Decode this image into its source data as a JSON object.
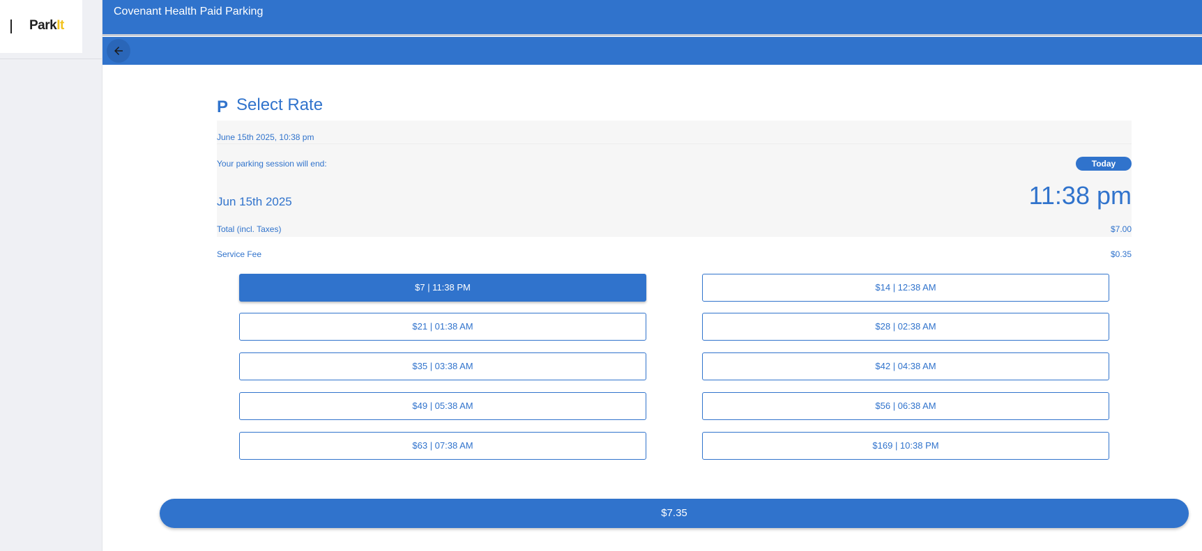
{
  "brand": {
    "logo_main": "Park",
    "logo_accent": "It"
  },
  "header": {
    "title": "Covenant Health Paid Parking"
  },
  "nav": {
    "back_icon": "arrow-left-icon"
  },
  "page": {
    "icon_glyph": "P",
    "title": "Select Rate"
  },
  "session": {
    "current_datetime": "June 15th 2025, 10:38 pm",
    "end_label": "Your parking session will end:",
    "badge": "Today",
    "end_date": "Jun 15th 2025",
    "end_time": "11:38 pm"
  },
  "fees": {
    "total_label": "Total (incl. Taxes)",
    "total_amount": "$7.00",
    "service_label": "Service Fee",
    "service_amount": "$0.35"
  },
  "rates": [
    {
      "label": "$7 | 11:38 PM",
      "selected": true
    },
    {
      "label": "$14 | 12:38 AM",
      "selected": false
    },
    {
      "label": "$21 | 01:38 AM",
      "selected": false
    },
    {
      "label": "$28 | 02:38 AM",
      "selected": false
    },
    {
      "label": "$35 | 03:38 AM",
      "selected": false
    },
    {
      "label": "$42 | 04:38 AM",
      "selected": false
    },
    {
      "label": "$49 | 05:38 AM",
      "selected": false
    },
    {
      "label": "$56 | 06:38 AM",
      "selected": false
    },
    {
      "label": "$63 | 07:38 AM",
      "selected": false
    },
    {
      "label": "$169 | 10:38 PM",
      "selected": false
    }
  ],
  "pay_button": {
    "label": "$7.35"
  },
  "colors": {
    "primary": "#3073cc",
    "accent": "#f2c21c"
  }
}
